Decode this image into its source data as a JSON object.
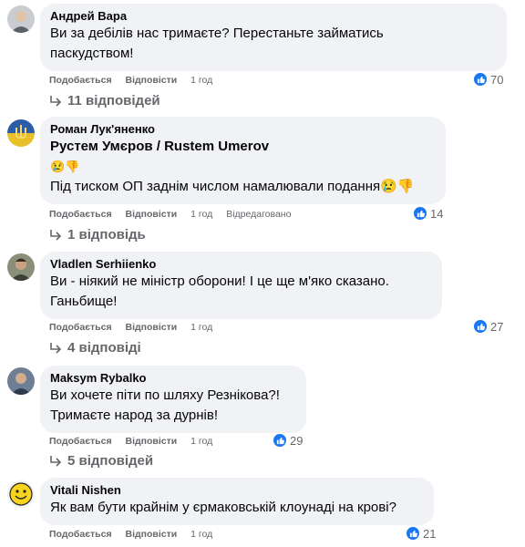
{
  "actions": {
    "like": "Подобається",
    "reply": "Відповісти"
  },
  "comments": [
    {
      "author": "Андрей Вара",
      "lines": [
        "Ви за дебілів нас тримаєте? Перестаньте займатись",
        "паскудством!"
      ],
      "time": "1 год",
      "likes": "70",
      "replies": "11 відповідей"
    },
    {
      "author": "Роман Лук'яненко",
      "mention": "Рустем Умєров / Rustem Umerov",
      "emoji_line": "😢👎",
      "lines": [
        "Під тиском ОП заднім числом намалювали подання😢👎"
      ],
      "time": "1 год",
      "edited": "Відредаговано",
      "likes": "14",
      "replies": "1 відповідь"
    },
    {
      "author": "Vladlen Serhiienko",
      "lines": [
        "Ви - ніякий не міністр оборони! І це ще м'яко сказано.",
        "Ганьбище!"
      ],
      "time": "1 год",
      "likes": "27",
      "replies": "4 відповіді"
    },
    {
      "author": "Maksym Rybalko",
      "lines": [
        "Ви хочете піти по шляху Резнікова?!",
        "Тримаєте народ за дурнів!"
      ],
      "time": "1 год",
      "likes": "29",
      "replies": "5 відповідей"
    },
    {
      "author": "Vitali Nishen",
      "lines": [
        "Як вам бути крайнім у єрмаковській клоунаді на крові?"
      ],
      "time": "1 год",
      "likes": "21"
    }
  ]
}
